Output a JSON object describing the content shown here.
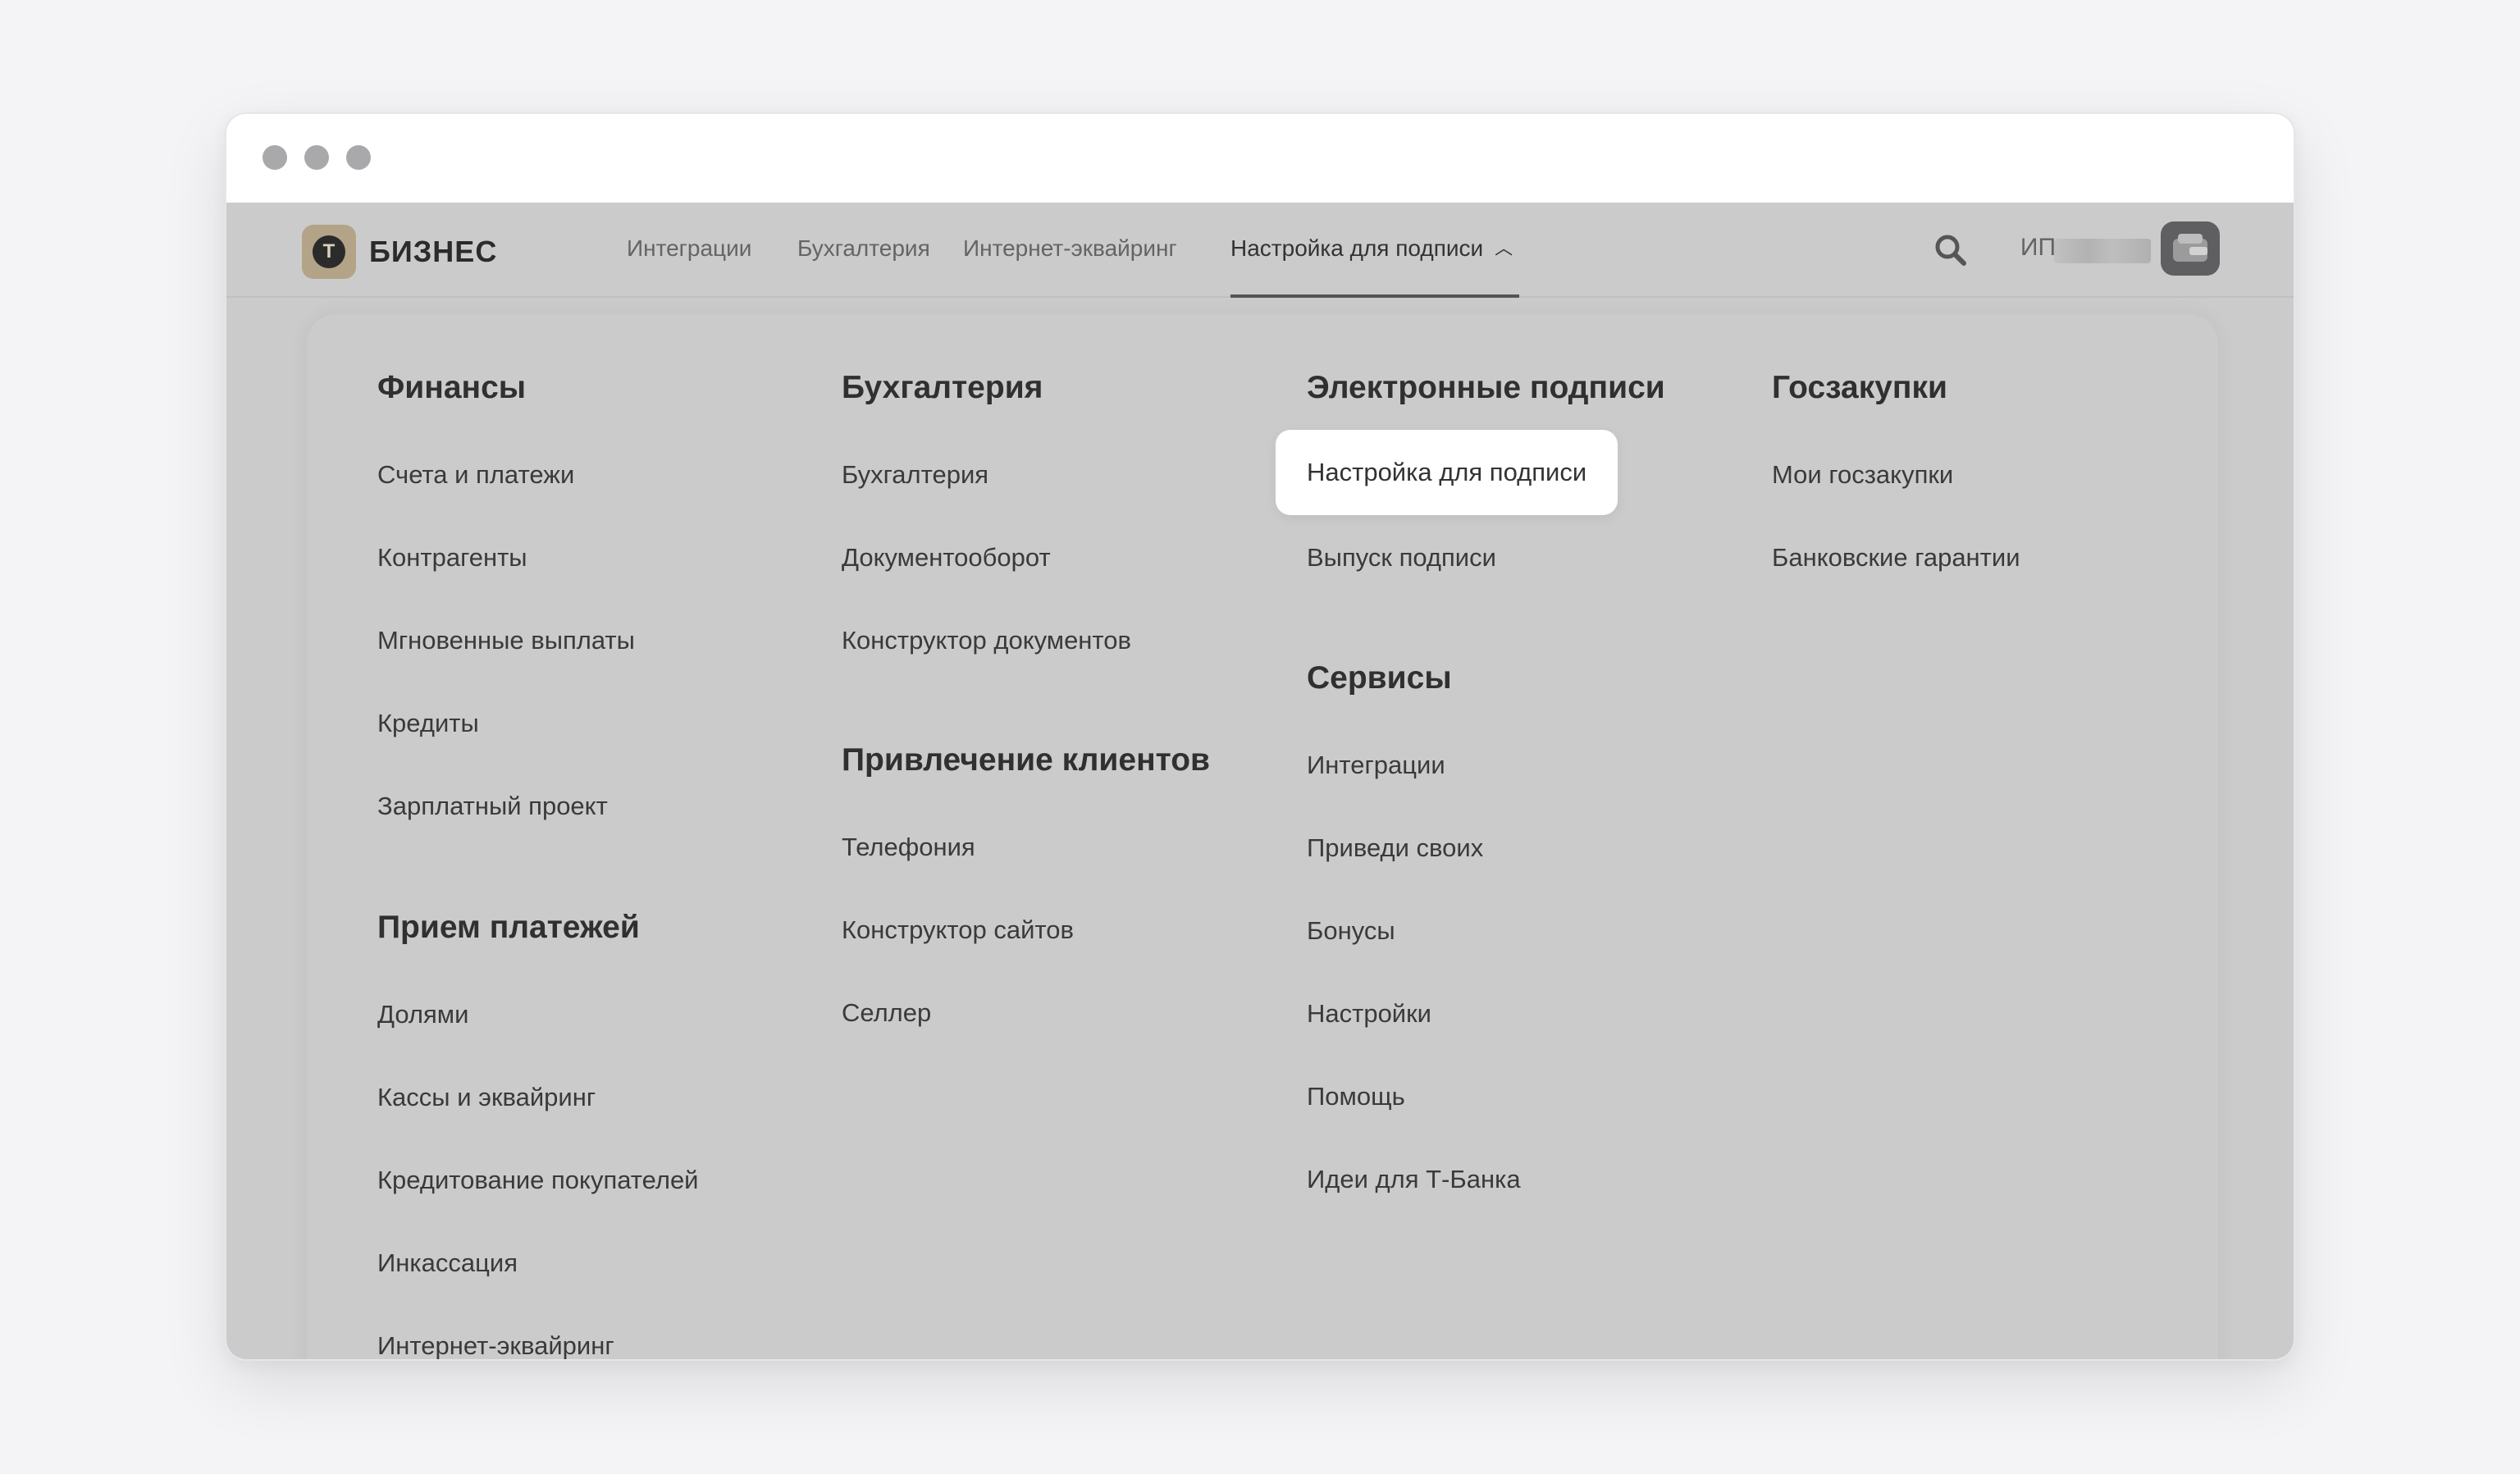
{
  "brand": {
    "logo_letter": "Т",
    "name": "БИЗНЕС"
  },
  "topnav": {
    "links": [
      {
        "label": "Интеграции"
      },
      {
        "label": "Бухгалтерия"
      },
      {
        "label": "Интернет-эквайринг"
      },
      {
        "label": "Настройка для подписи",
        "active": true
      }
    ],
    "user_prefix": "ИП"
  },
  "menu": {
    "columns": [
      {
        "groups": [
          {
            "title": "Финансы",
            "items": [
              "Счета и платежи",
              "Контрагенты",
              "Мгновенные выплаты",
              "Кредиты",
              "Зарплатный проект"
            ]
          },
          {
            "title": "Прием платежей",
            "items": [
              "Долями",
              "Кассы и эквайринг",
              "Кредитование покупателей",
              "Инкассация",
              "Интернет-эквайринг"
            ]
          }
        ]
      },
      {
        "groups": [
          {
            "title": "Бухгалтерия",
            "items": [
              "Бухгалтерия",
              "Документооборот",
              "Конструктор документов"
            ]
          },
          {
            "title": "Привлечение клиентов",
            "items": [
              "Телефония",
              "Конструктор сайтов",
              "Селлер"
            ]
          }
        ]
      },
      {
        "groups": [
          {
            "title": "Электронные подписи",
            "items": [
              "Настройка для подписи",
              "Выпуск подписи"
            ],
            "highlighted_item": "Настройка для подписи"
          },
          {
            "title": "Сервисы",
            "items": [
              "Интеграции",
              "Приведи своих",
              "Бонусы",
              "Настройки",
              "Помощь",
              "Идеи для Т-Банка"
            ]
          }
        ]
      },
      {
        "groups": [
          {
            "title": "Госзакупки",
            "items": [
              "Мои госзакупки",
              "Банковские гарантии"
            ]
          }
        ]
      }
    ]
  },
  "colors": {
    "overlay": "#cbcbcb",
    "brand": "#b3a487",
    "highlight": "#ffffff"
  }
}
